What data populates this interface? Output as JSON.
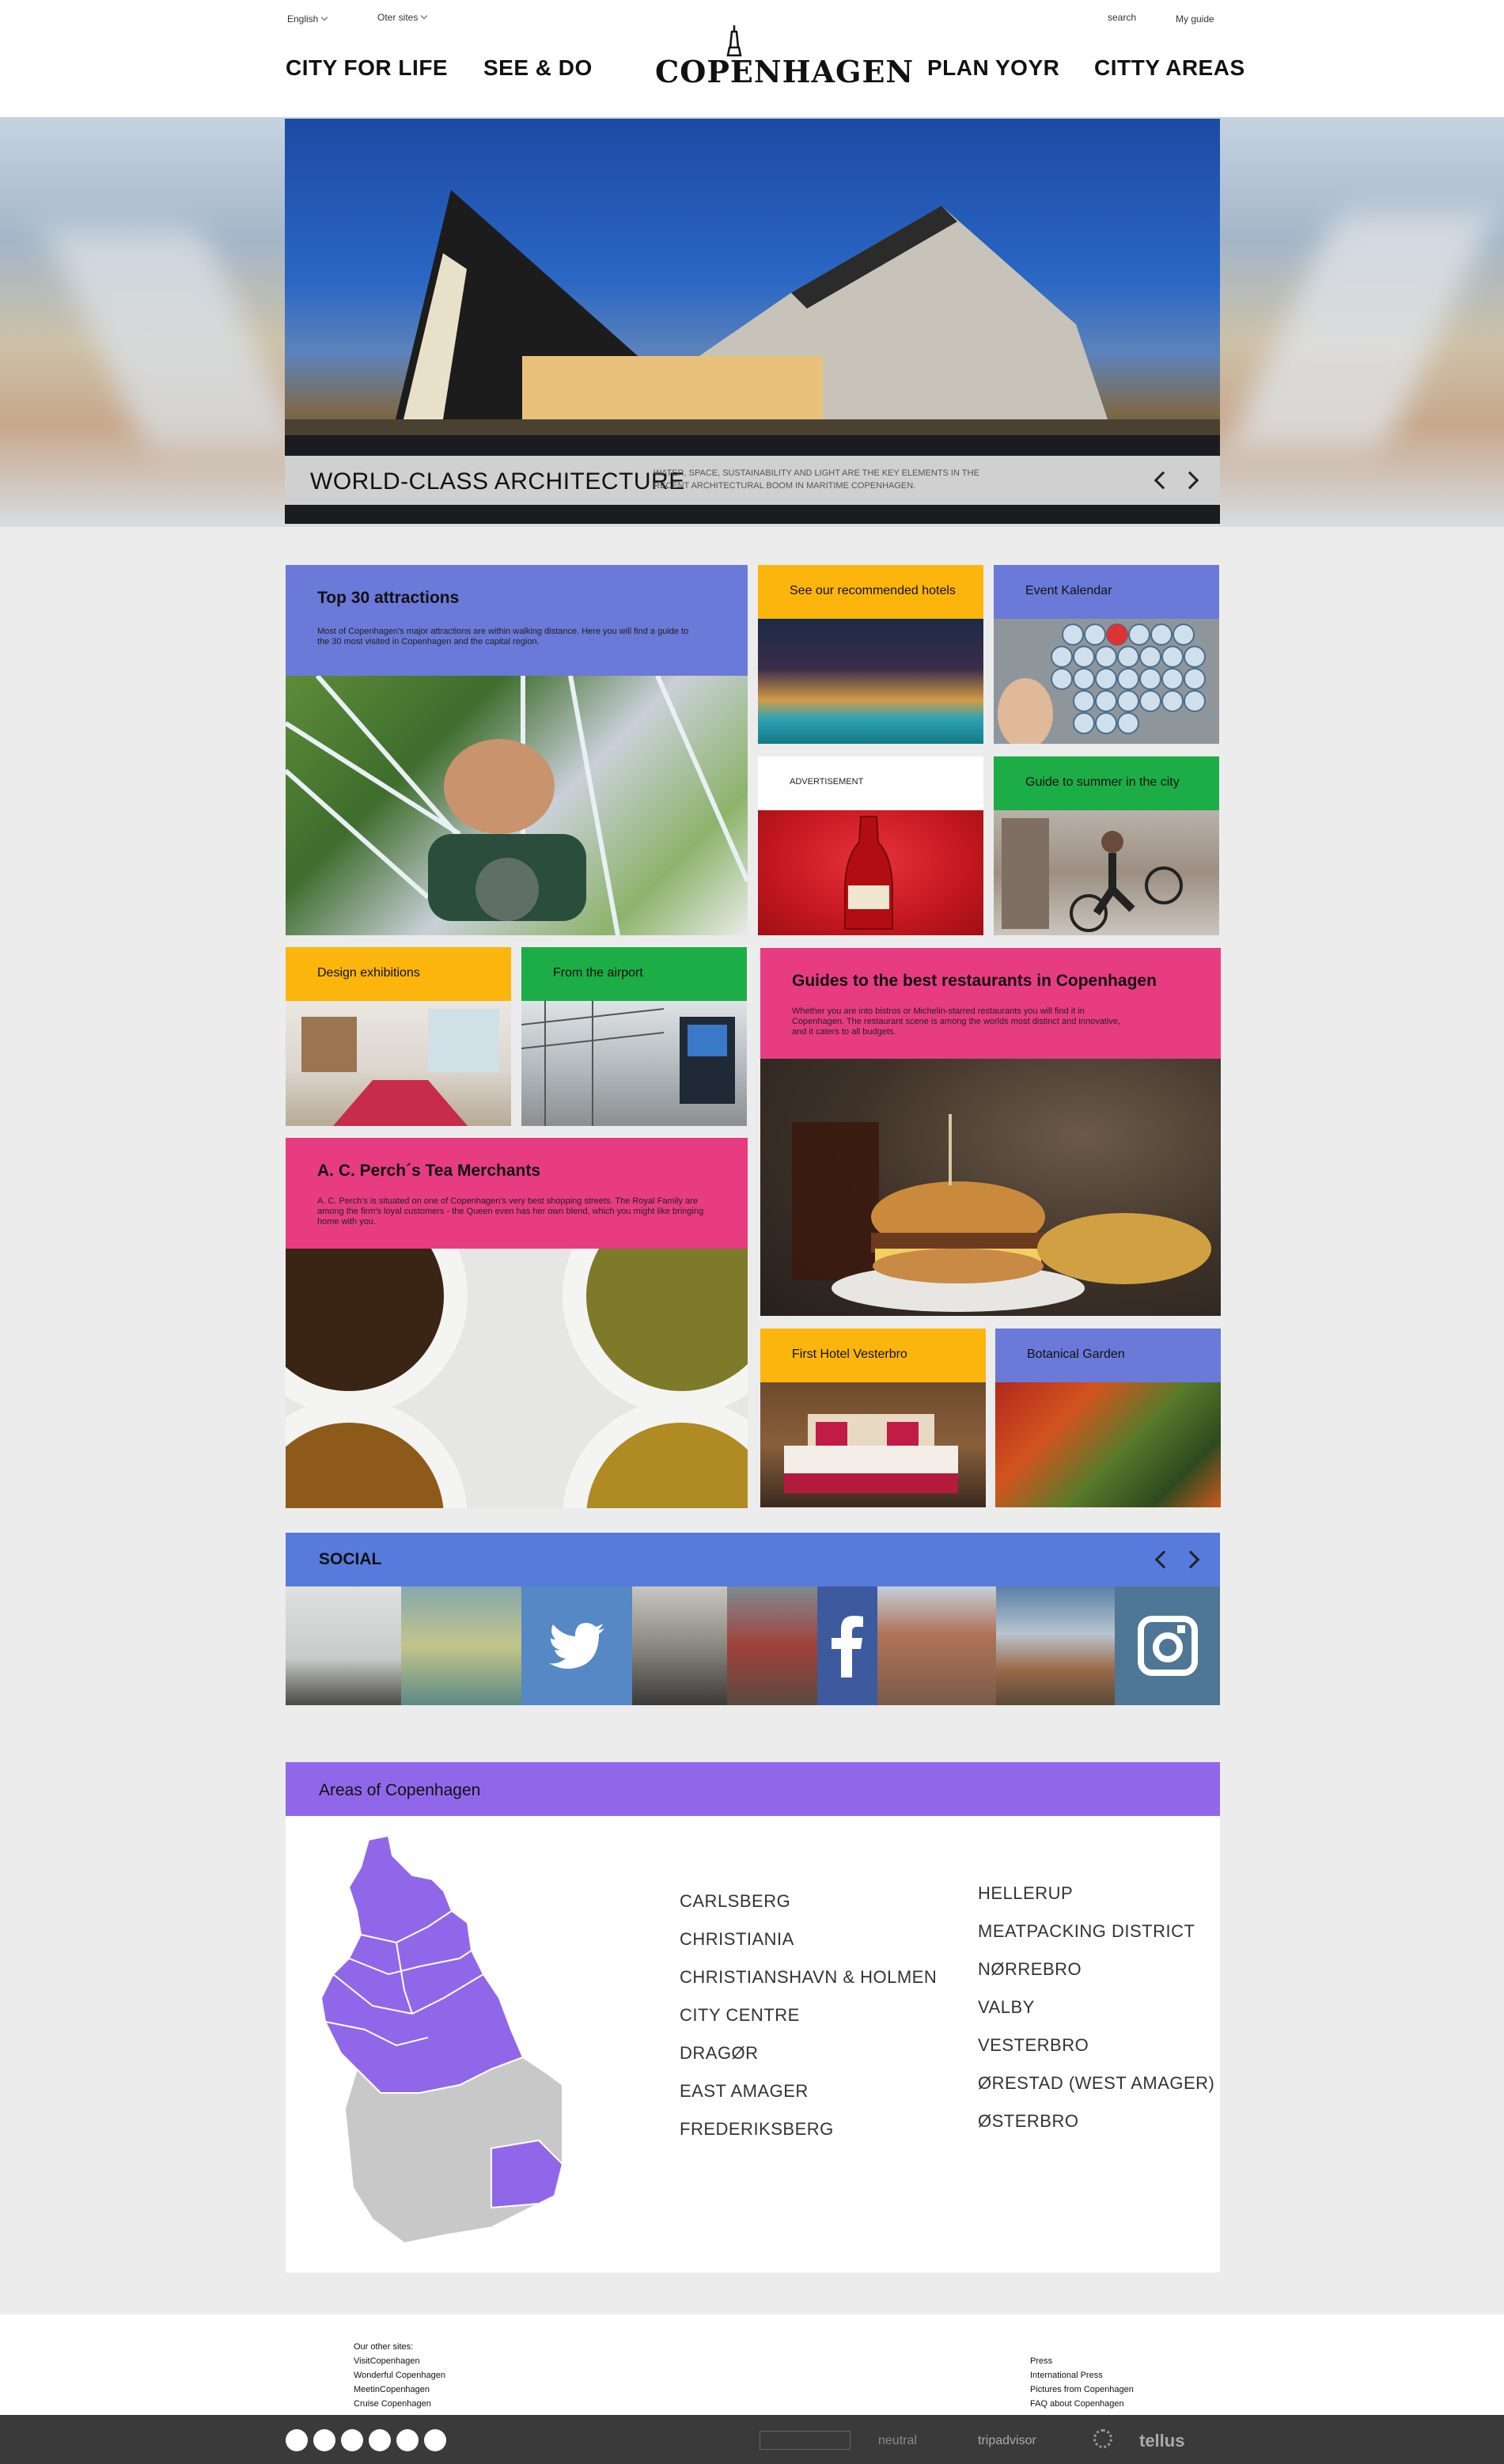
{
  "header": {
    "language": "English",
    "other_sites": "Oter sites",
    "search": "search",
    "my_guide": "My guide",
    "nav_left": [
      "CITY FOR LIFE",
      "SEE & DO"
    ],
    "nav_right": [
      "PLAN YOYR",
      "CITTY AREAS"
    ],
    "logo": "COPENHAGEN"
  },
  "hero": {
    "title": "WORLD-CLASS ARCHITECTURE",
    "description": "WATER, SPACE, SUSTAINABILITY AND LIGHT ARE THE KEY ELEMENTS IN THE RECENT ARCHITECTURAL BOOM IN MARITIME COPENHAGEN."
  },
  "tiles": {
    "top30": {
      "title": "Top 30 attractions",
      "text": "Most of Copenhagen's major attractions are within walking distance. Here you will find a guide to the 30 most visited in Copenhagen and the capital region."
    },
    "hotels": {
      "title": "See our recommended hotels"
    },
    "events": {
      "title": "Event Kalendar"
    },
    "advertisement": {
      "title": "ADVERTISEMENT"
    },
    "summer": {
      "title": "Guide to summer in the city"
    },
    "design": {
      "title": "Design exhibitions"
    },
    "airport": {
      "title": "From the airport"
    },
    "restaurants": {
      "title": "Guides to the best restaurants in Copenhagen",
      "text": "Whether you are into bistros or Michelin-starred restaurants you will find it in Copenhagen. The restaurant scene is among the worlds most distinct and innovative, and it caters to all budgets."
    },
    "tea": {
      "title": "A. C. Perch´s Tea Merchants",
      "text": "A. C. Perch's is situated on one of Copenhagen's very best shopping streets. The Royal Family are among the firm's loyal customers - the Queen even has her own blend, which you might like bringing home with you."
    },
    "first_hotel": {
      "title": "First Hotel Vesterbro"
    },
    "botanical": {
      "title": "Botanical Garden"
    }
  },
  "social": {
    "title": "SOCIAL",
    "icons": [
      "twitter-icon",
      "facebook-icon",
      "instagram-icon"
    ]
  },
  "areas": {
    "title": "Areas of Copenhagen",
    "col1": [
      "CARLSBERG",
      "CHRISTIANIA",
      "CHRISTIANSHAVN & HOLMEN",
      "CITY CENTRE",
      "DRAGØR",
      "EAST AMAGER",
      "FREDERIKSBERG"
    ],
    "col2": [
      "HELLERUP",
      "MEATPACKING DISTRICT",
      "NØRREBRO",
      "VALBY",
      "VESTERBRO",
      "ØRESTAD (WEST AMAGER)",
      "ØSTERBRO"
    ]
  },
  "footer": {
    "other_sites_label": "Our other sites:",
    "other_sites": [
      "VisitCopenhagen",
      "Wonderful Copenhagen",
      "MeetinCopenhagen",
      "Cruise Copenhagen"
    ],
    "right_links": [
      "Press",
      "International Press",
      "Pictures from Copenhagen",
      "FAQ about Copenhagen"
    ],
    "partners": [
      "tripadvisor",
      "tellus",
      "neutral"
    ]
  },
  "colors": {
    "blue": "#6b79d8",
    "yellow": "#fbb50c",
    "green": "#1cad47",
    "pink": "#e83c82",
    "purple": "#9167ea",
    "social_blue": "#577bdc"
  }
}
